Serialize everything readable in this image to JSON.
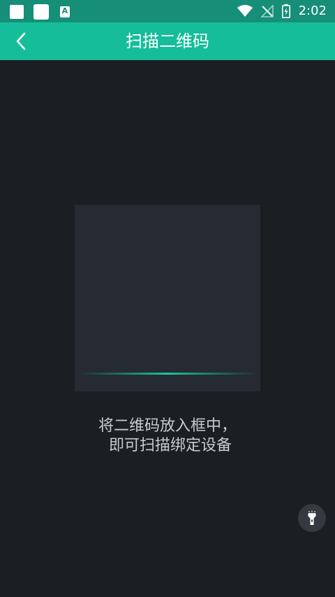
{
  "status_bar": {
    "time": "2:02",
    "left_icons": [
      "notification-square-icon",
      "notification-square-icon",
      "translate-a-icon"
    ],
    "a_glyph": "A",
    "right_icons": [
      "wifi-icon",
      "no-signal-icon",
      "battery-charging-icon"
    ]
  },
  "app_bar": {
    "title": "扫描二维码",
    "back_icon": "chevron-left-icon",
    "color": "#15bd9a"
  },
  "scanner": {
    "hint_line1": "将二维码放入框中，",
    "hint_line2": "即可扫描绑定设备",
    "line_color": "#19c6a0"
  },
  "torch": {
    "icon": "flashlight-icon"
  }
}
